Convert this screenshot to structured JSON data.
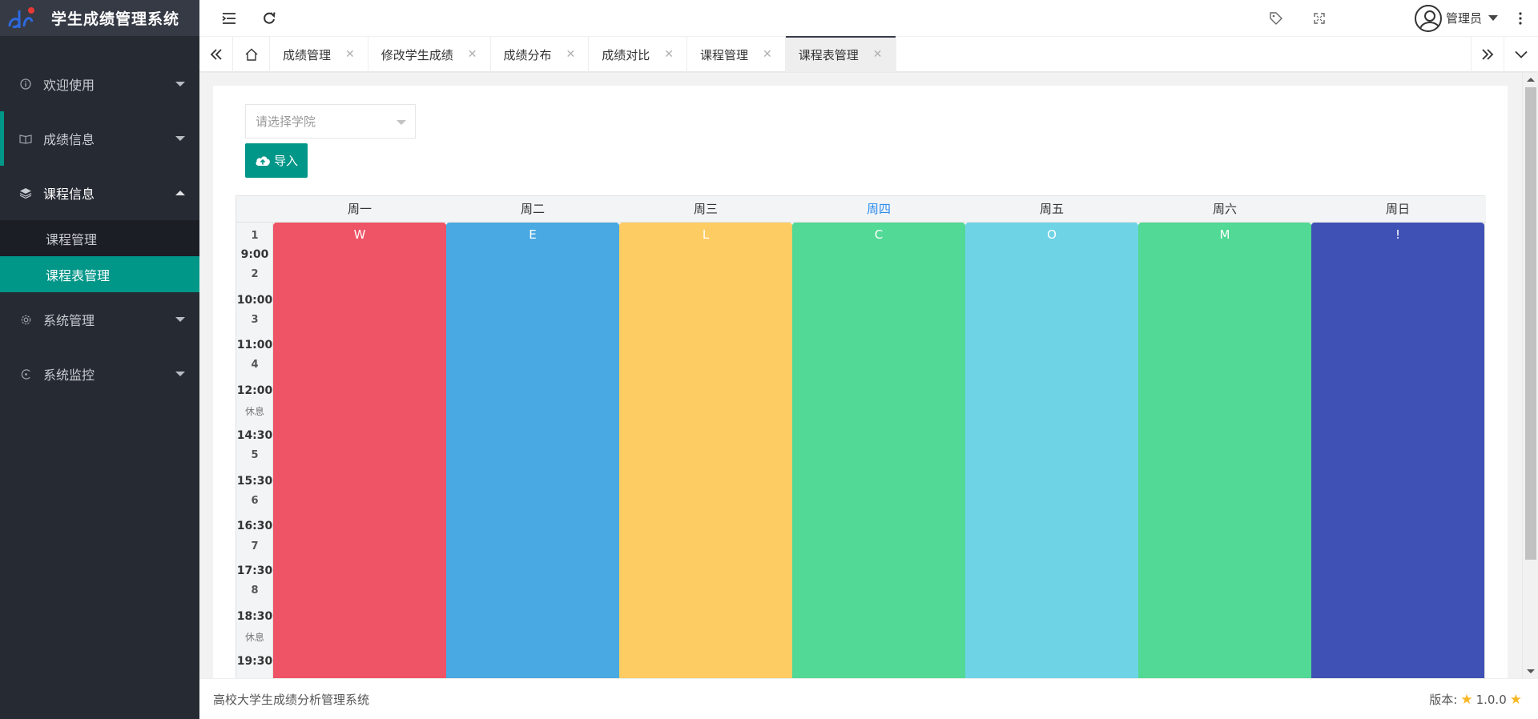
{
  "app": {
    "title": "学生成绩管理系统",
    "footer_text": "高校大学生成绩分析管理系统",
    "version_label": "版本:",
    "version": "1.0.0"
  },
  "sidebar": {
    "items": [
      {
        "label": "欢迎使用",
        "icon": "info-icon",
        "expanded": false
      },
      {
        "label": "成绩信息",
        "icon": "book-icon",
        "expanded": false
      },
      {
        "label": "课程信息",
        "icon": "layers-icon",
        "expanded": true,
        "children": [
          {
            "label": "课程管理",
            "selected": false
          },
          {
            "label": "课程表管理",
            "selected": true
          }
        ]
      },
      {
        "label": "系统管理",
        "icon": "gear-icon",
        "expanded": false
      },
      {
        "label": "系统监控",
        "icon": "monitor-icon",
        "expanded": false
      }
    ]
  },
  "header": {
    "user_name": "管理员"
  },
  "tabs": [
    {
      "label": "成绩管理"
    },
    {
      "label": "修改学生成绩"
    },
    {
      "label": "成绩分布"
    },
    {
      "label": "成绩对比"
    },
    {
      "label": "课程管理"
    },
    {
      "label": "课程表管理",
      "active": true
    }
  ],
  "toolbar": {
    "college_placeholder": "请选择学院",
    "import_label": "导入"
  },
  "timetable": {
    "days": [
      "周一",
      "周二",
      "周三",
      "周四",
      "周五",
      "周六",
      "周日"
    ],
    "today_index": 3,
    "slots": [
      {
        "num": "1",
        "time": "9:00"
      },
      {
        "num": "2",
        "time": "10:00"
      },
      {
        "num": "3",
        "time": "11:00"
      },
      {
        "num": "4",
        "time": "12:00"
      },
      {
        "num": "休息",
        "time": "14:30",
        "rest": true
      },
      {
        "num": "5",
        "time": "15:30"
      },
      {
        "num": "6",
        "time": "16:30"
      },
      {
        "num": "7",
        "time": "17:30"
      },
      {
        "num": "8",
        "time": "18:30"
      },
      {
        "num": "休息",
        "time": "19:30",
        "rest": true
      }
    ],
    "courses": [
      {
        "label": "W",
        "color": "#ef5366"
      },
      {
        "label": "E",
        "color": "#49a9e2"
      },
      {
        "label": "L",
        "color": "#fdcc62"
      },
      {
        "label": "C",
        "color": "#51d995"
      },
      {
        "label": "O",
        "color": "#6ed3e5"
      },
      {
        "label": "M",
        "color": "#51d995"
      },
      {
        "label": "!",
        "color": "#3f51b5"
      }
    ]
  },
  "colors": {
    "sidebar_bg": "#262a33",
    "accent": "#009688",
    "today": "#2d8cf0"
  }
}
